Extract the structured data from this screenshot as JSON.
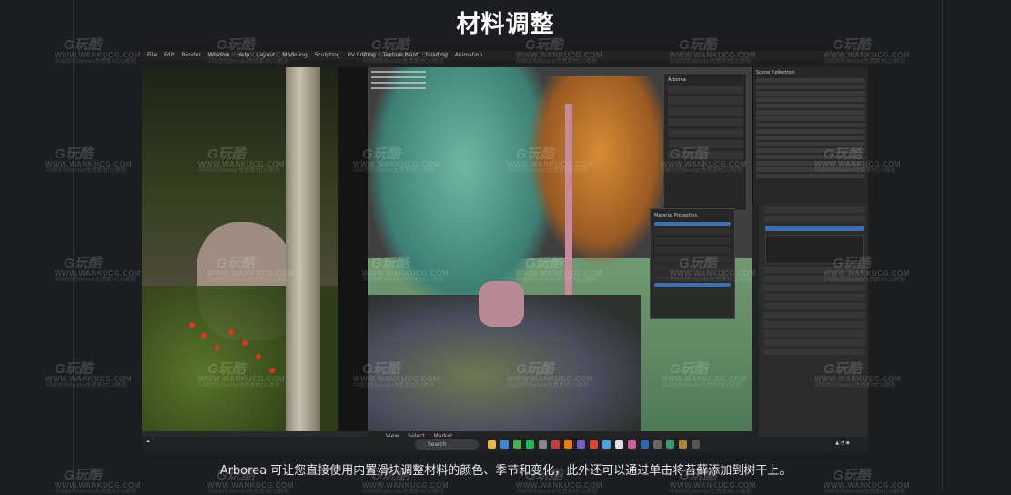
{
  "slide": {
    "title": "材料调整",
    "caption": "Arborea 可让您直接使用内置滑块调整材料的颜色、季节和变化，此外还可以通过单击将苔藓添加到树干上。"
  },
  "watermark": {
    "logo": "G玩酷",
    "url": "WWW.WANKUCG.COM",
    "sub": "中国领先Blender免费素材CG教程"
  },
  "blender": {
    "menu": [
      "File",
      "Edit",
      "Render",
      "Window",
      "Help",
      "Layout",
      "Modeling",
      "Sculpting",
      "UV Editing",
      "Texture Paint",
      "Shading",
      "Animation"
    ],
    "panel_title": "Arborea",
    "material_panel_title": "Material Properties",
    "outliner_title": "Scene Collection",
    "footer_items": [
      "View",
      "Select",
      "Marker"
    ],
    "icons": [
      "blender-icon",
      "tree-icon",
      "gear-icon"
    ]
  },
  "taskbar": {
    "search_placeholder": "Search"
  },
  "colors": {
    "background": "#1b1d21",
    "accent": "#3e6fb0",
    "teal_tree": "#6fb7a2",
    "orange_tree": "#d68b34",
    "berry": "#e0351e"
  }
}
